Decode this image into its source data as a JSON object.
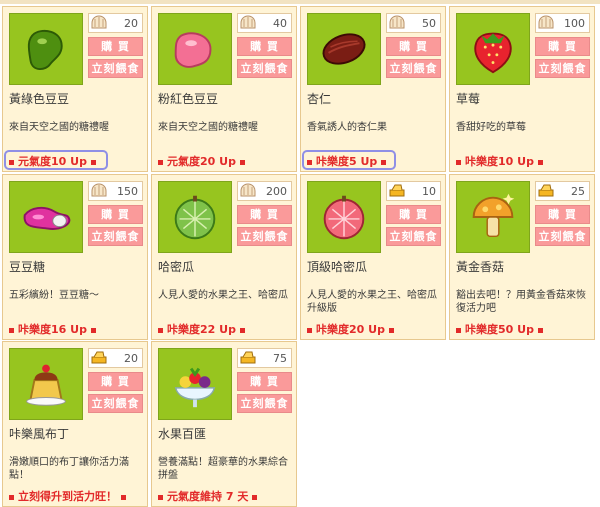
{
  "colors": {
    "card_bg": "#fff4d6",
    "thumb_bg": "#97c51f",
    "button_bg": "#fa9a9a",
    "effect_red": "#e22a2a",
    "highlight": "#8f8fe6"
  },
  "buttons": {
    "buy": "購 買",
    "feed": "立刻餵食"
  },
  "items": [
    {
      "name": "黃綠色豆豆",
      "price": "20",
      "currency_icon": "shell-icon",
      "desc": "來自天空之國的糖禮喔",
      "effect": "元氣度10 Up",
      "highlighted": true,
      "image_icon": "green-bean-icon"
    },
    {
      "name": "粉紅色豆豆",
      "price": "40",
      "currency_icon": "shell-icon",
      "desc": "來自天空之國的糖禮喔",
      "effect": "元氣度20 Up",
      "highlighted": false,
      "image_icon": "pink-bean-icon"
    },
    {
      "name": "杏仁",
      "price": "50",
      "currency_icon": "shell-icon",
      "desc": "香氣誘人的杏仁果",
      "effect": "咔樂度5 Up",
      "highlighted": true,
      "image_icon": "almond-icon"
    },
    {
      "name": "草莓",
      "price": "100",
      "currency_icon": "shell-icon",
      "desc": "香甜好吃的草莓",
      "effect": "咔樂度10 Up",
      "highlighted": false,
      "image_icon": "strawberry-icon"
    },
    {
      "name": "豆豆糖",
      "price": "150",
      "currency_icon": "shell-icon",
      "desc": "五彩繽紛！豆豆糖～",
      "effect": "咔樂度16 Up",
      "highlighted": false,
      "image_icon": "bean-candy-icon"
    },
    {
      "name": "哈密瓜",
      "price": "200",
      "currency_icon": "shell-icon",
      "desc": "人見人愛的水果之王、哈密瓜",
      "effect": "咔樂度22 Up",
      "highlighted": false,
      "image_icon": "melon-icon"
    },
    {
      "name": "頂級哈密瓜",
      "price": "10",
      "currency_icon": "gold-icon",
      "desc": "人見人愛的水果之王、哈密瓜升級版",
      "effect": "咔樂度20 Up",
      "highlighted": false,
      "image_icon": "premium-melon-icon"
    },
    {
      "name": "黃金香菇",
      "price": "25",
      "currency_icon": "gold-icon",
      "desc": "豁出去吧！？用黃金香菇來恢復活力吧",
      "effect": "咔樂度50 Up",
      "highlighted": false,
      "image_icon": "golden-mushroom-icon"
    },
    {
      "name": "咔樂風布丁",
      "price": "20",
      "currency_icon": "gold-icon",
      "desc": "滑嫩順口的布丁讓你活力滿點！",
      "effect": "立刻得升到活力旺！",
      "highlighted": false,
      "image_icon": "pudding-icon"
    },
    {
      "name": "水果百匯",
      "price": "75",
      "currency_icon": "gold-icon",
      "desc": "營養滿點！超豪華的水果綜合拼盤",
      "effect": "元氣度維持 7 天",
      "highlighted": false,
      "image_icon": "fruit-platter-icon"
    }
  ]
}
